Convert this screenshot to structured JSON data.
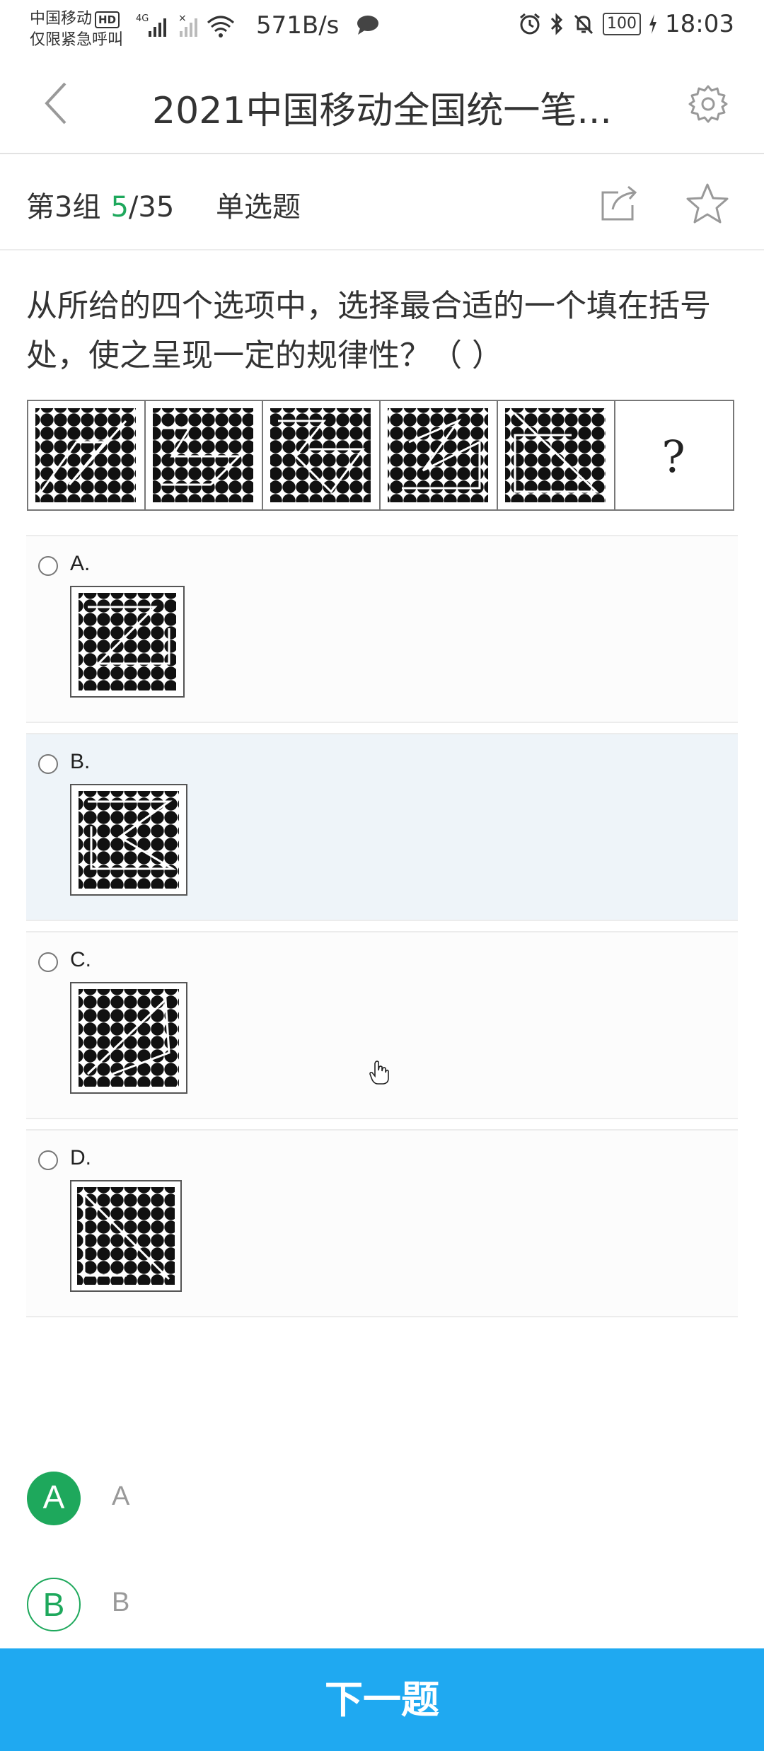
{
  "status_bar": {
    "carrier_line1": "中国移动",
    "hd_badge": "HD",
    "carrier_line2": "仅限紧急呼叫",
    "network_type": "4G",
    "net_speed": "571B/s",
    "battery": "100",
    "time": "18:03",
    "icons": [
      "signal-icon",
      "wifi-icon",
      "chat-bubble-icon",
      "alarm-icon",
      "bluetooth-icon",
      "mute-bell-icon",
      "battery-icon",
      "charging-icon"
    ]
  },
  "header": {
    "title": "2021中国移动全国统一笔...",
    "back_icon": "chevron-left-icon",
    "settings_icon": "gear-icon"
  },
  "info_bar": {
    "group": "第3组",
    "current": "5",
    "total": "/35",
    "question_type": "单选题",
    "share_icon": "share-icon",
    "star_icon": "star-icon"
  },
  "question": {
    "text": "从所给的四个选项中，选择最合适的一个填在括号处，使之呈现一定的规律性？（ ）",
    "placeholder_mark": "?"
  },
  "options": [
    {
      "label": "A.",
      "selected": false
    },
    {
      "label": "B.",
      "selected": true
    },
    {
      "label": "C.",
      "selected": false
    },
    {
      "label": "D.",
      "selected": false
    }
  ],
  "answer_choices": [
    {
      "letter": "A",
      "text": "A",
      "style": "filled"
    },
    {
      "letter": "B",
      "text": "B",
      "style": "outline"
    }
  ],
  "next_button": "下一题",
  "colors": {
    "accent_green": "#1ea85c",
    "next_blue": "#1fa9f1",
    "selected_bg": "#eef4f9"
  }
}
